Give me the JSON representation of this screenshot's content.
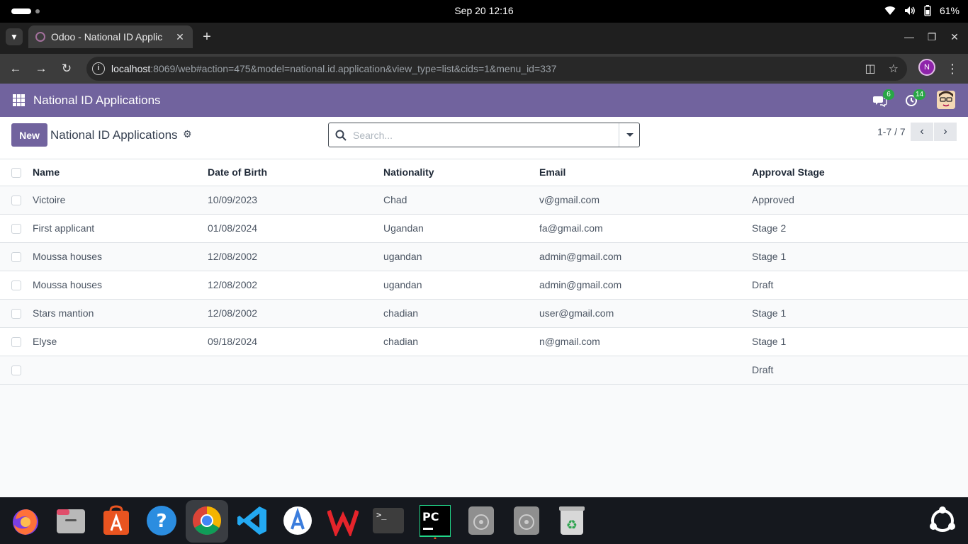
{
  "os": {
    "clock": "Sep 20  12:16",
    "battery": "61%"
  },
  "browser": {
    "tab_title": "Odoo - National ID Applic",
    "tab_close": "✕",
    "new_tab": "+",
    "url_host": "localhost",
    "url_rest": ":8069/web#action=475&model=national.id.application&view_type=list&cids=1&menu_id=337",
    "profile_initial": "N"
  },
  "odoo": {
    "app_title": "National ID Applications",
    "messages_count": "6",
    "activities_count": "14",
    "new_label": "New",
    "breadcrumb": "National ID Applications",
    "search_placeholder": "Search...",
    "pager": "1-7 / 7"
  },
  "table": {
    "headers": {
      "name": "Name",
      "dob": "Date of Birth",
      "nationality": "Nationality",
      "email": "Email",
      "stage": "Approval Stage"
    },
    "rows": [
      {
        "name": "Victoire",
        "dob": "10/09/2023",
        "nationality": "Chad",
        "email": "v@gmail.com",
        "stage": "Approved"
      },
      {
        "name": "First applicant",
        "dob": "01/08/2024",
        "nationality": "Ugandan",
        "email": "fa@gmail.com",
        "stage": "Stage 2"
      },
      {
        "name": "Moussa houses",
        "dob": "12/08/2002",
        "nationality": "ugandan",
        "email": "admin@gmail.com",
        "stage": "Stage 1"
      },
      {
        "name": "Moussa houses",
        "dob": "12/08/2002",
        "nationality": "ugandan",
        "email": "admin@gmail.com",
        "stage": "Draft"
      },
      {
        "name": "Stars mantion",
        "dob": "12/08/2002",
        "nationality": "chadian",
        "email": "user@gmail.com",
        "stage": "Stage 1"
      },
      {
        "name": "Elyse",
        "dob": "09/18/2024",
        "nationality": "chadian",
        "email": "n@gmail.com",
        "stage": "Stage 1"
      },
      {
        "name": "",
        "dob": "",
        "nationality": "",
        "email": "",
        "stage": "Draft"
      }
    ]
  },
  "colors": {
    "odoo_primary": "#71639e",
    "badge_green": "#28a745"
  },
  "dock": {
    "apps": [
      "firefox-icon",
      "files-icon",
      "app-center-icon",
      "help-icon",
      "chrome-icon",
      "vscode-icon",
      "android-studio-icon",
      "wps-office-icon",
      "terminal-icon",
      "pycharm-icon",
      "disk-icon",
      "disk-icon-2",
      "trash-icon",
      "ubuntu-apps-icon"
    ]
  }
}
